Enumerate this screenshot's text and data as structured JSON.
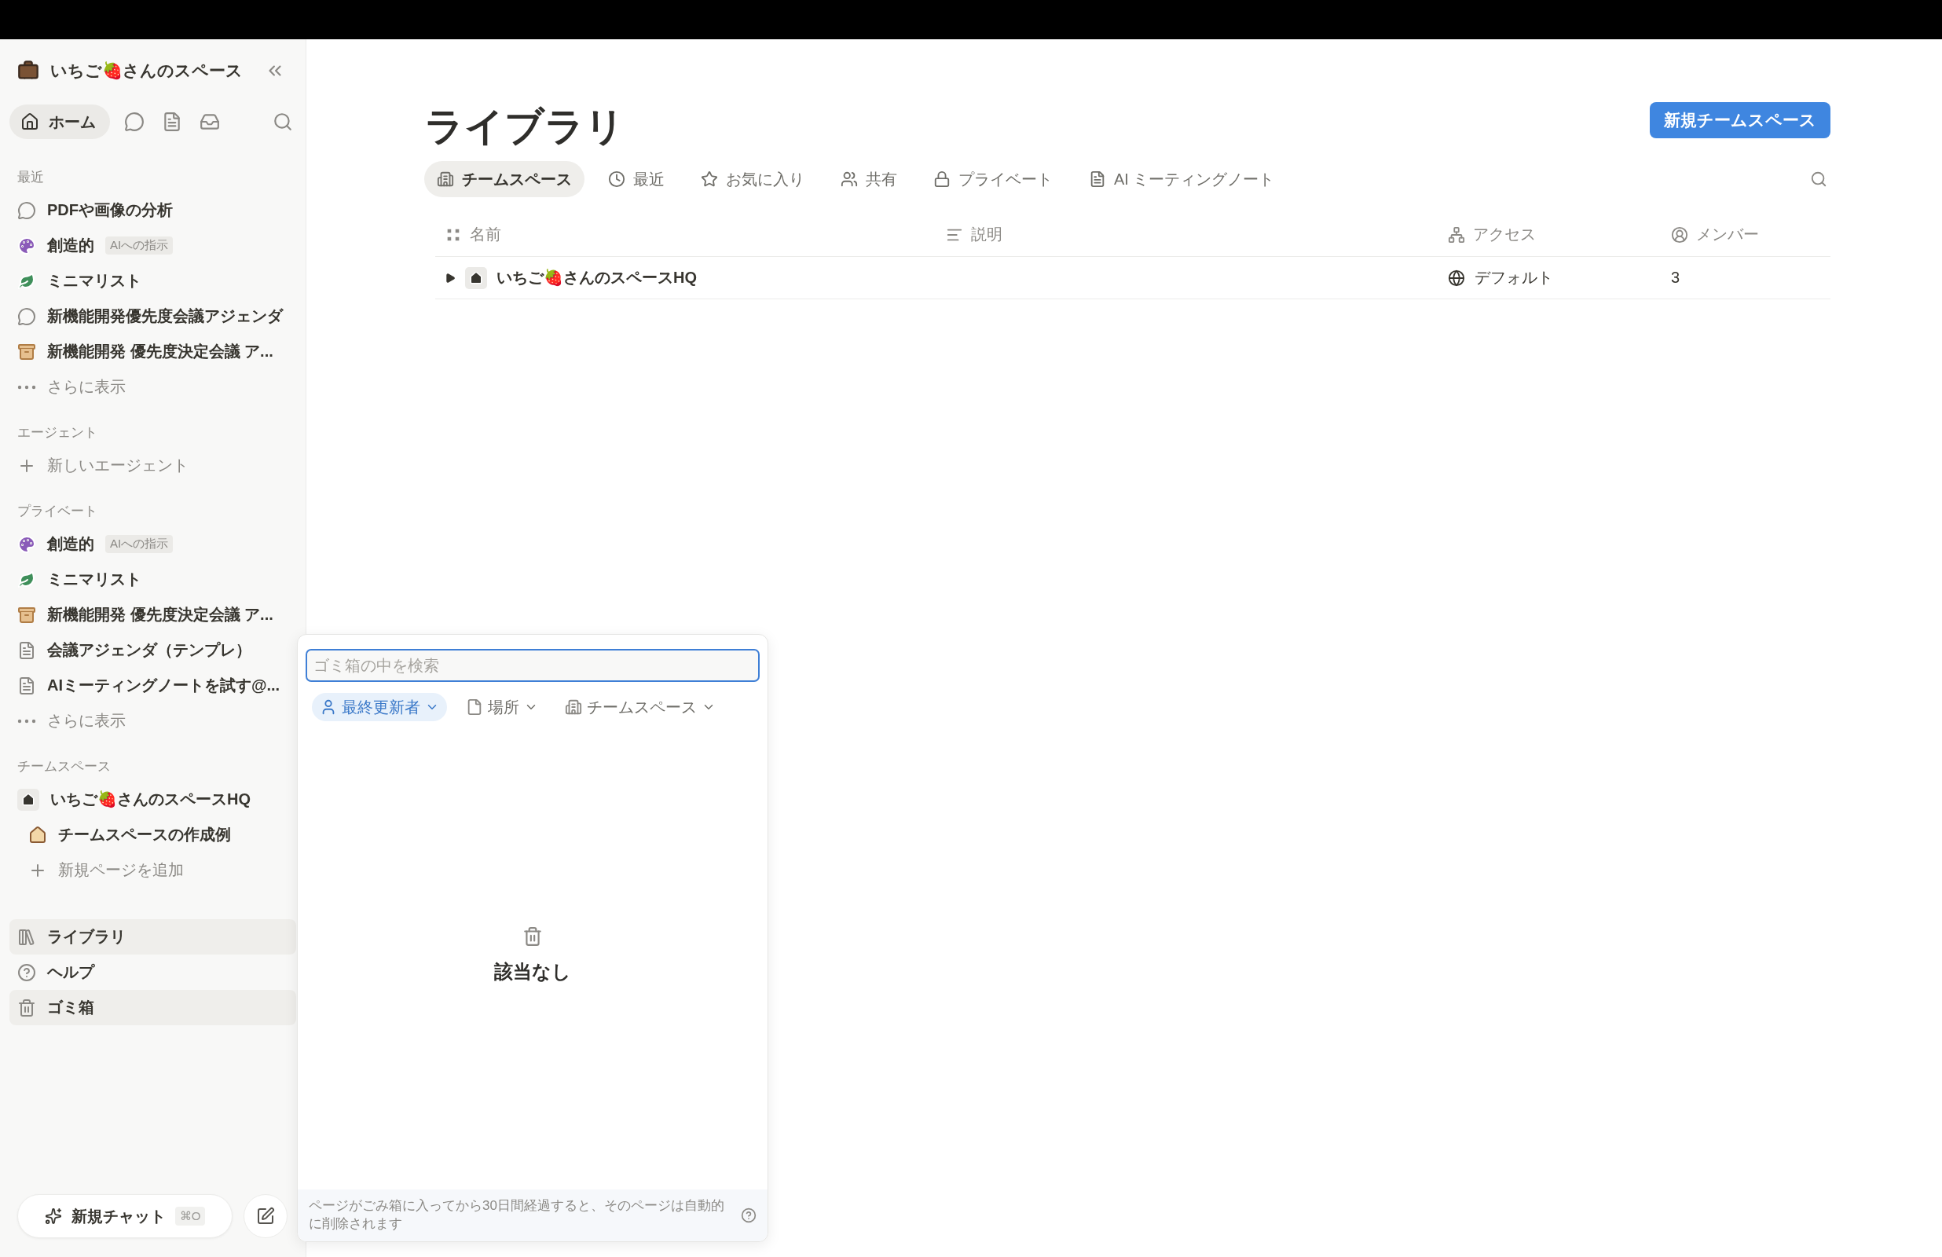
{
  "sidebar": {
    "workspace_name": "いちご🍓さんのスペース",
    "home": {
      "label": "ホーム",
      "selected": true
    },
    "sections": [
      {
        "title": "最近",
        "items": [
          {
            "kind": "chat",
            "label": "PDFや画像の分析"
          },
          {
            "kind": "palette",
            "label": "創造的",
            "tag": "AIへの指示"
          },
          {
            "kind": "leaf",
            "label": "ミニマリスト"
          },
          {
            "kind": "chat",
            "label": "新機能開発優先度会議アジェンダ"
          },
          {
            "kind": "box",
            "label": "新機能開発 優先度決定会議 ア..."
          },
          {
            "kind": "more",
            "label": "さらに表示"
          }
        ]
      },
      {
        "title": "エージェント",
        "items": [
          {
            "kind": "add",
            "label": "新しいエージェント"
          }
        ]
      },
      {
        "title": "プライベート",
        "items": [
          {
            "kind": "palette",
            "label": "創造的",
            "tag": "AIへの指示"
          },
          {
            "kind": "leaf",
            "label": "ミニマリスト"
          },
          {
            "kind": "box",
            "label": "新機能開発 優先度決定会議 ア..."
          },
          {
            "kind": "page",
            "label": "会議アジェンダ（テンプレ）"
          },
          {
            "kind": "page",
            "label": "AIミーティングノートを試す@..."
          },
          {
            "kind": "more",
            "label": "さらに表示"
          }
        ]
      },
      {
        "title": "チームスペース",
        "items": [
          {
            "kind": "hq",
            "label": "いちご🍓さんのスペースHQ",
            "children": [
              {
                "kind": "house",
                "label": "チームスペースの作成例"
              },
              {
                "kind": "add",
                "label": "新規ページを追加"
              }
            ]
          }
        ]
      }
    ],
    "footer_items": [
      {
        "kind": "library",
        "label": "ライブラリ",
        "selected": true
      },
      {
        "kind": "help",
        "label": "ヘルプ",
        "selected": false
      },
      {
        "kind": "trash",
        "label": "ゴミ箱",
        "selected": true
      }
    ],
    "new_chat": {
      "label": "新規チャット",
      "shortcut": "⌘O"
    }
  },
  "main": {
    "title": "ライブラリ",
    "new_button": "新規チームスペース",
    "tabs": [
      {
        "kind": "building",
        "label": "チームスペース",
        "selected": true
      },
      {
        "kind": "clock",
        "label": "最近",
        "selected": false
      },
      {
        "kind": "star",
        "label": "お気に入り",
        "selected": false
      },
      {
        "kind": "users",
        "label": "共有",
        "selected": false
      },
      {
        "kind": "lock",
        "label": "プライベート",
        "selected": false
      },
      {
        "kind": "note",
        "label": "AI ミーティングノート",
        "selected": false
      }
    ],
    "table": {
      "columns": [
        {
          "kind": "grid",
          "label": "名前"
        },
        {
          "kind": "lines",
          "label": "説明"
        },
        {
          "kind": "network",
          "label": "アクセス"
        },
        {
          "kind": "person",
          "label": "メンバー"
        }
      ],
      "rows": [
        {
          "name": "いちご🍓さんのスペースHQ",
          "access": "デフォルト",
          "members": "3",
          "expanded": false
        }
      ]
    }
  },
  "trash_popup": {
    "search": {
      "placeholder": "ゴミ箱の中を検索"
    },
    "filters": [
      {
        "kind": "person",
        "label": "最終更新者",
        "selected": true
      },
      {
        "kind": "page",
        "label": "場所",
        "selected": false
      },
      {
        "kind": "building",
        "label": "チームスペース",
        "selected": false
      }
    ],
    "empty_text": "該当なし",
    "note": "ページがごみ箱に入ってから30日間経過すると、そのページは自動的に削除されます"
  }
}
